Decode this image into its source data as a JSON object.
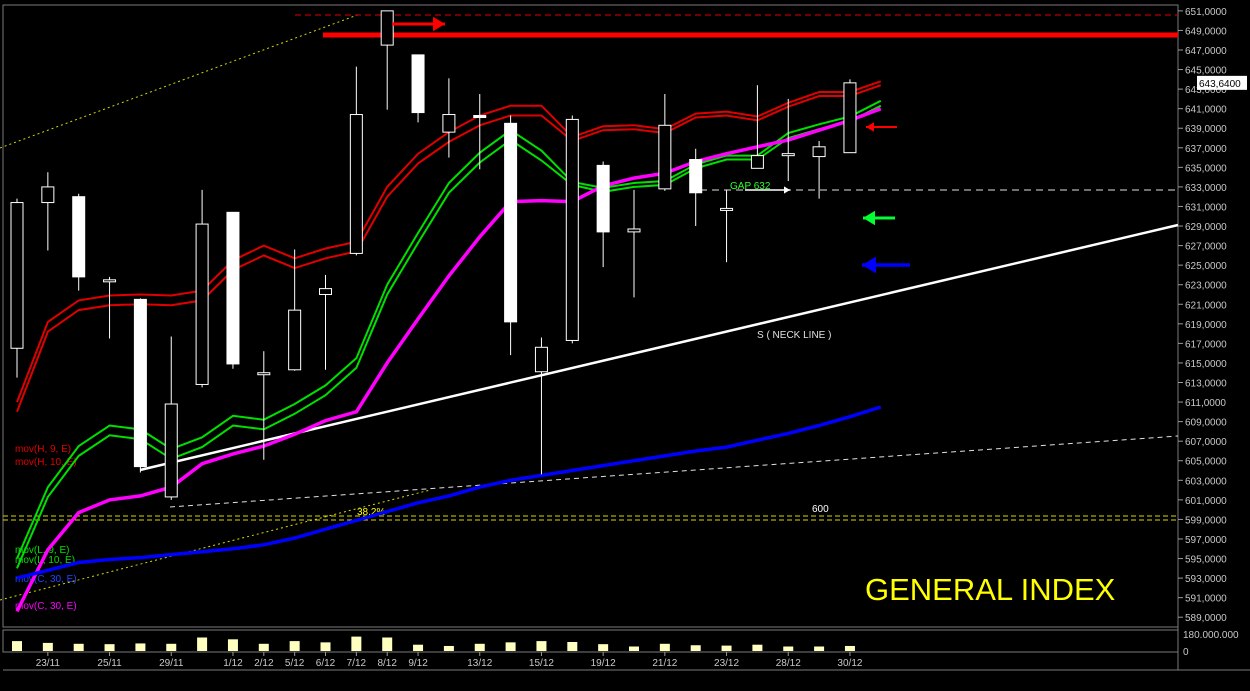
{
  "chart_data": {
    "type": "candlestick",
    "title": "GENERAL INDEX",
    "ylim": [
      588000,
      651600
    ],
    "y_ticks": [
      589000,
      591000,
      593000,
      595000,
      597000,
      599000,
      601000,
      603000,
      605000,
      607000,
      609000,
      611000,
      613000,
      615000,
      617000,
      619000,
      621000,
      623000,
      625000,
      627000,
      629000,
      631000,
      633000,
      635000,
      637000,
      639000,
      641000,
      643000,
      645000,
      647000,
      649000,
      651000
    ],
    "y_tick_labels": [
      "589,0000",
      "591,0000",
      "593,0000",
      "595,0000",
      "597,0000",
      "599,0000",
      "601,0000",
      "603,0000",
      "605,0000",
      "607,0000",
      "609,0000",
      "611,0000",
      "613,0000",
      "615,0000",
      "617,0000",
      "619,0000",
      "621,0000",
      "623,0000",
      "625,0000",
      "627,0000",
      "629,0000",
      "631,0000",
      "633,0000",
      "635,0000",
      "637,0000",
      "639,0000",
      "641,0000",
      "643,0000",
      "645,0000",
      "647,0000",
      "649,0000",
      "651,0000"
    ],
    "last_price_label": "643,6400",
    "last_price": 643640,
    "volume_axis_labels": [
      "180.000.000",
      "0"
    ],
    "x_labels": [
      {
        "i": 1,
        "text": "23/11"
      },
      {
        "i": 3,
        "text": "25/11"
      },
      {
        "i": 5,
        "text": "29/11"
      },
      {
        "i": 7,
        "text": "1/12"
      },
      {
        "i": 8,
        "text": "2/12"
      },
      {
        "i": 9,
        "text": "5/12"
      },
      {
        "i": 10,
        "text": "6/12"
      },
      {
        "i": 11,
        "text": "7/12"
      },
      {
        "i": 12,
        "text": "8/12"
      },
      {
        "i": 13,
        "text": "9/12"
      },
      {
        "i": 15,
        "text": "13/12"
      },
      {
        "i": 17,
        "text": "15/12"
      },
      {
        "i": 19,
        "text": "19/12"
      },
      {
        "i": 21,
        "text": "21/12"
      },
      {
        "i": 23,
        "text": "23/12"
      },
      {
        "i": 25,
        "text": "28/12"
      },
      {
        "i": 27,
        "text": "30/12"
      }
    ],
    "candles": [
      {
        "o": 616500,
        "h": 631800,
        "l": 613500,
        "c": 631400
      },
      {
        "o": 631400,
        "h": 634500,
        "l": 626500,
        "c": 633000
      },
      {
        "o": 632000,
        "h": 632300,
        "l": 622400,
        "c": 623800
      },
      {
        "o": 623500,
        "h": 623800,
        "l": 617500,
        "c": 623500
      },
      {
        "o": 621500,
        "h": 621600,
        "l": 603800,
        "c": 604400
      },
      {
        "o": 601300,
        "h": 617700,
        "l": 601000,
        "c": 610800
      },
      {
        "o": 612800,
        "h": 632700,
        "l": 612500,
        "c": 629200
      },
      {
        "o": 630400,
        "h": 630400,
        "l": 614400,
        "c": 614900
      },
      {
        "o": 613800,
        "h": 616200,
        "l": 605100,
        "c": 614000
      },
      {
        "o": 614300,
        "h": 626600,
        "l": 614200,
        "c": 620400
      },
      {
        "o": 622000,
        "h": 624000,
        "l": 614300,
        "c": 622600
      },
      {
        "o": 626200,
        "h": 645300,
        "l": 626000,
        "c": 640400
      },
      {
        "o": 647500,
        "h": 651000,
        "l": 640900,
        "c": 651000
      },
      {
        "o": 646500,
        "h": 646500,
        "l": 639600,
        "c": 640600
      },
      {
        "o": 638600,
        "h": 644100,
        "l": 636000,
        "c": 640400
      },
      {
        "o": 640300,
        "h": 642500,
        "l": 634800,
        "c": 640100
      },
      {
        "o": 639500,
        "h": 640300,
        "l": 615800,
        "c": 619200
      },
      {
        "o": 614100,
        "h": 617600,
        "l": 603600,
        "c": 616600
      },
      {
        "o": 617300,
        "h": 640300,
        "l": 617000,
        "c": 639900
      },
      {
        "o": 635200,
        "h": 635600,
        "l": 624800,
        "c": 628400
      },
      {
        "o": 628400,
        "h": 632700,
        "l": 621700,
        "c": 628700
      },
      {
        "o": 632800,
        "h": 642500,
        "l": 632600,
        "c": 639300
      },
      {
        "o": 635800,
        "h": 636900,
        "l": 629000,
        "c": 632400
      },
      {
        "o": 630700,
        "h": 632700,
        "l": 625300,
        "c": 630800
      },
      {
        "o": 634900,
        "h": 643400,
        "l": 634900,
        "c": 636200
      },
      {
        "o": 636200,
        "h": 642000,
        "l": 633600,
        "c": 636400
      },
      {
        "o": 636100,
        "h": 637700,
        "l": 631800,
        "c": 637100
      },
      {
        "o": 636500,
        "h": 644000,
        "l": 636500,
        "c": 643640
      }
    ],
    "series": [
      {
        "name": "mov(H, 9, E)",
        "color": "#e00000",
        "values": [
          611000,
          619200,
          621400,
          621900,
          622000,
          621900,
          622400,
          625500,
          627000,
          625700,
          626700,
          627400,
          633000,
          636400,
          638600,
          640300,
          641300,
          641300,
          638100,
          639200,
          639300,
          638900,
          640500,
          640700,
          640200,
          641600,
          642700,
          642700,
          643800
        ]
      },
      {
        "name": "mov(H, 10, E)",
        "color": "#e00000",
        "values": [
          610000,
          618200,
          620400,
          620900,
          621000,
          620900,
          621400,
          624500,
          626000,
          624700,
          625700,
          626400,
          632000,
          635400,
          637600,
          639300,
          640300,
          640300,
          637700,
          638800,
          638900,
          638500,
          640100,
          640300,
          639800,
          641200,
          642300,
          642300,
          643400
        ]
      },
      {
        "name": "mov(L, 9, E)",
        "color": "#00e000",
        "values": [
          595000,
          602300,
          606500,
          608600,
          608200,
          606200,
          607400,
          609600,
          609200,
          610800,
          612700,
          615500,
          623000,
          628300,
          633400,
          636500,
          638800,
          636700,
          633500,
          632900,
          633400,
          633600,
          635300,
          636200,
          636200,
          638500,
          639400,
          640200,
          641800
        ]
      },
      {
        "name": "mov(L, 10, E)",
        "color": "#00e000",
        "values": [
          594000,
          601300,
          605500,
          607600,
          607200,
          605200,
          606400,
          608600,
          608200,
          609800,
          611700,
          614500,
          622000,
          627300,
          632400,
          635500,
          637800,
          635700,
          633200,
          632500,
          633000,
          633200,
          634900,
          635800,
          635800,
          638000,
          638900,
          639700,
          641300
        ]
      },
      {
        "name": "mov(C, 30, E)",
        "color": "#ff00ff",
        "values": [
          589600,
          595900,
          599700,
          601000,
          601400,
          602300,
          604700,
          605700,
          606500,
          607700,
          609100,
          610000,
          615000,
          619500,
          623900,
          627900,
          631500,
          631600,
          631500,
          633100,
          633900,
          634400,
          635600,
          636400,
          637100,
          637800,
          638800,
          639800,
          641000
        ]
      },
      {
        "name": "600",
        "color": "#0000ff",
        "values": [
          593000,
          593800,
          594600,
          594900,
          595100,
          595400,
          595700,
          596000,
          596400,
          597100,
          598000,
          598900,
          599800,
          600700,
          601400,
          602300,
          603000,
          603500,
          604000,
          604500,
          605000,
          605500,
          606000,
          606400,
          607100,
          607800,
          608600,
          609500,
          610500
        ]
      }
    ],
    "volumes": [
      55,
      45,
      40,
      38,
      42,
      40,
      75,
      65,
      40,
      55,
      48,
      80,
      75,
      35,
      28,
      40,
      48,
      55,
      50,
      38,
      25,
      40,
      32,
      30,
      35,
      25,
      25,
      28
    ],
    "volume_max": 180000000,
    "annotations": {
      "gap": "GAP 632",
      "neckline": "S ( NECK LINE )",
      "fib": "38,2%",
      "level_600": "600",
      "legend": [
        "mov(H, 9, E)",
        "mov(H, 10, E)",
        "mov(L, 9, E)",
        "mov(L, 10, E)",
        "mov(C, 30, E)",
        "mov(C, 30, E)"
      ]
    }
  }
}
